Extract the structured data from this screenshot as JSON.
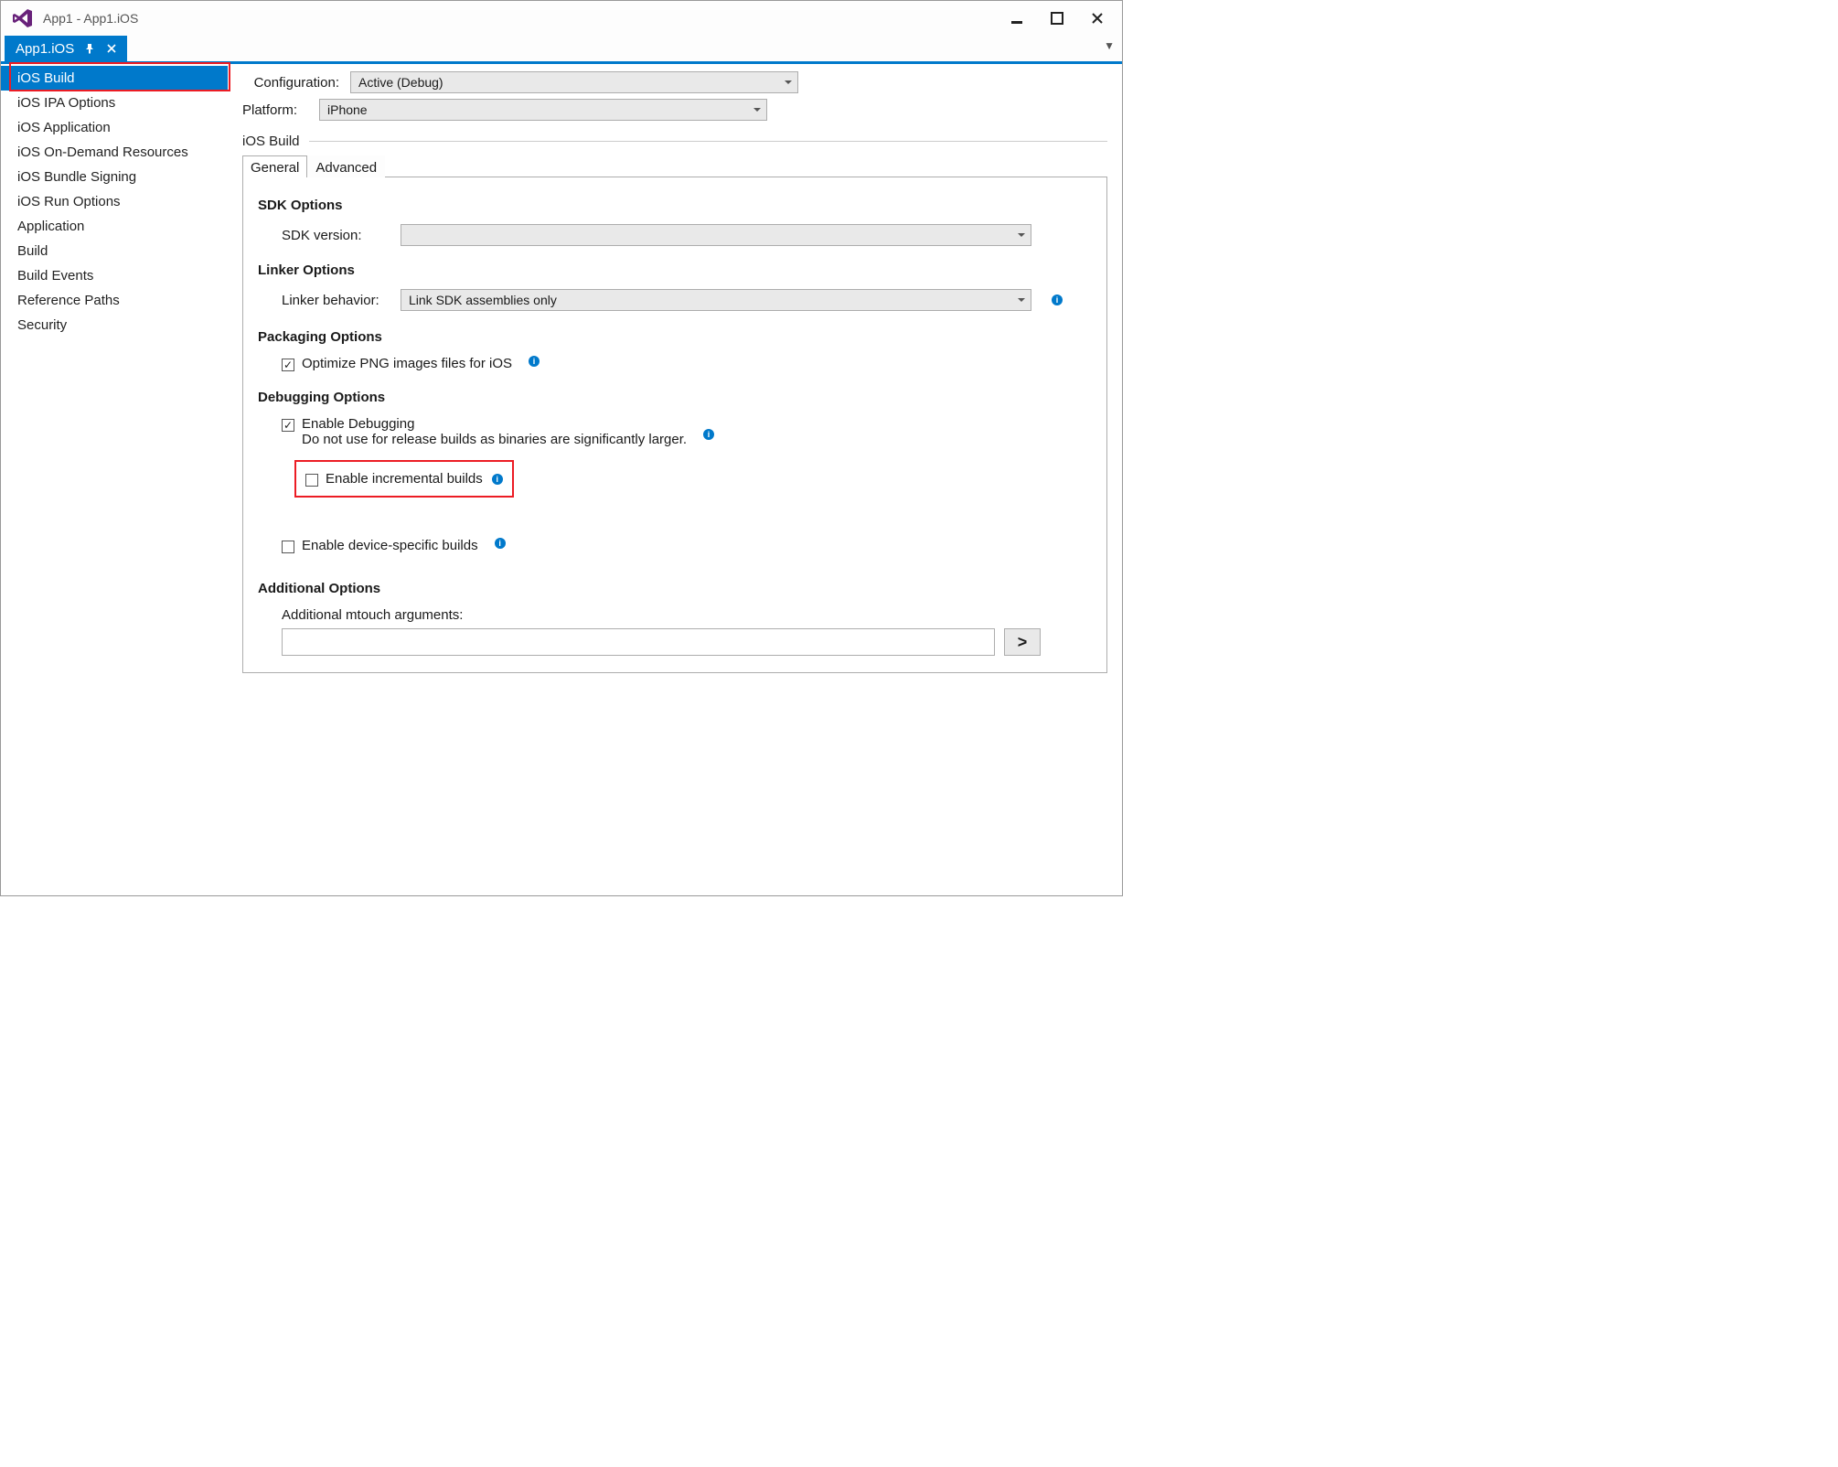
{
  "window": {
    "title": "App1 - App1.iOS"
  },
  "docTab": {
    "label": "App1.iOS"
  },
  "sidebar": {
    "items": [
      {
        "label": "iOS Build",
        "selected": true
      },
      {
        "label": "iOS IPA Options"
      },
      {
        "label": "iOS Application"
      },
      {
        "label": "iOS On-Demand Resources"
      },
      {
        "label": "iOS Bundle Signing"
      },
      {
        "label": "iOS Run Options"
      },
      {
        "label": "Application"
      },
      {
        "label": "Build"
      },
      {
        "label": "Build Events"
      },
      {
        "label": "Reference Paths"
      },
      {
        "label": "Security"
      }
    ]
  },
  "config": {
    "configurationLabel": "Configuration:",
    "configurationValue": "Active (Debug)",
    "platformLabel": "Platform:",
    "platformValue": "iPhone"
  },
  "sectionTitle": "iOS Build",
  "subtabs": {
    "general": "General",
    "advanced": "Advanced"
  },
  "sdk": {
    "groupTitle": "SDK Options",
    "versionLabel": "SDK version:",
    "versionValue": ""
  },
  "linker": {
    "groupTitle": "Linker Options",
    "behaviorLabel": "Linker behavior:",
    "behaviorValue": "Link SDK assemblies only"
  },
  "packaging": {
    "groupTitle": "Packaging Options",
    "optimizePng": "Optimize PNG images files for iOS"
  },
  "debugging": {
    "groupTitle": "Debugging Options",
    "enableDebugging": "Enable Debugging",
    "enableDebuggingNote": "Do not use for release builds as binaries are significantly larger.",
    "enableIncremental": "Enable incremental builds",
    "enableDeviceSpecific": "Enable device-specific builds"
  },
  "additional": {
    "groupTitle": "Additional Options",
    "mtouchLabel": "Additional mtouch arguments:",
    "mtouchValue": "",
    "arrowGlyph": ">"
  }
}
